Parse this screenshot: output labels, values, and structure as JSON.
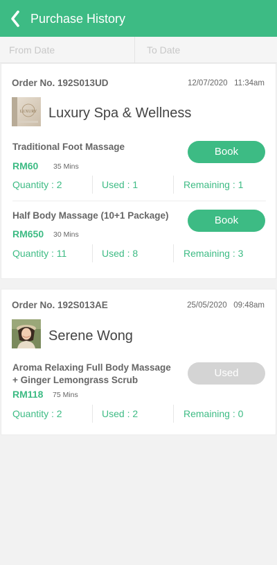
{
  "header": {
    "title": "Purchase History",
    "back_icon": "chevron-left-icon"
  },
  "filters": {
    "from_placeholder": "From Date",
    "to_placeholder": "To Date"
  },
  "orders": [
    {
      "order_no": "Order No. 192S013UD",
      "date": "12/07/2020",
      "time": "11:34am",
      "merchant": "Luxury Spa & Wellness",
      "logo_text": "LUXURY",
      "items": [
        {
          "service": "Traditional Foot Massage",
          "price": "RM60",
          "duration": "35 Mins",
          "action": "Book",
          "quantity": "Quantity : 2",
          "used": "Used : 1",
          "remaining": "Remaining : 1"
        },
        {
          "service": "Half Body Massage (10+1 Package)",
          "price": "RM650",
          "duration": "30 Mins",
          "action": "Book",
          "quantity": "Quantity : 11",
          "used": "Used : 8",
          "remaining": "Remaining : 3"
        }
      ]
    },
    {
      "order_no": "Order No. 192S013AE",
      "date": "25/05/2020",
      "time": "09:48am",
      "merchant": "Serene Wong",
      "items": [
        {
          "service_line1": "Aroma Relaxing Full Body Massage",
          "service_line2": "+ Ginger Lemongrass Scrub",
          "price": "RM118",
          "duration": "75 Mins",
          "action": "Used",
          "quantity": "Quantity : 2",
          "used": "Used : 2",
          "remaining": "Remaining : 0"
        }
      ]
    }
  ],
  "colors": {
    "accent": "#3dbb84",
    "disabled": "#d4d4d4",
    "text": "#666666"
  }
}
